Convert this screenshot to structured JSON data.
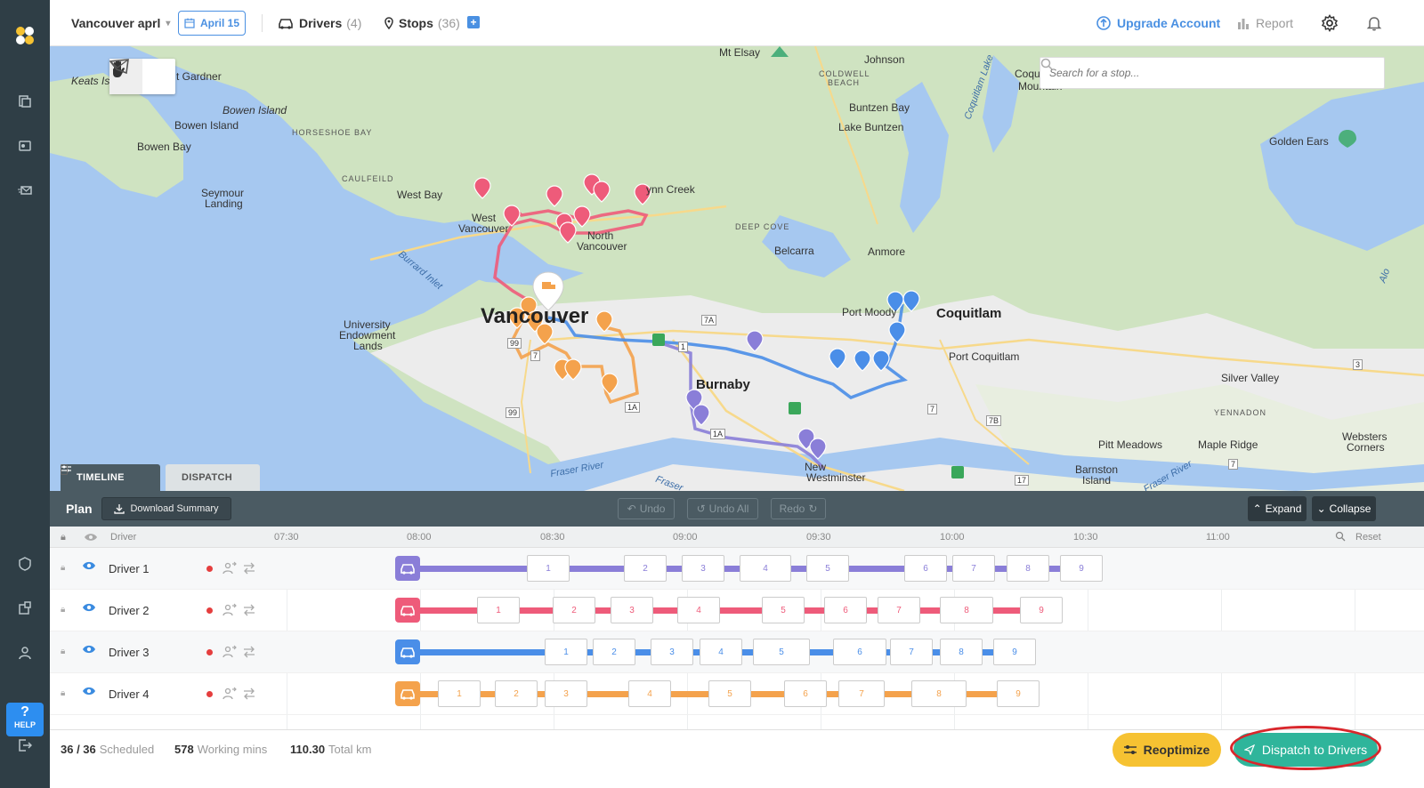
{
  "topbar": {
    "plan_name": "Vancouver aprl",
    "date": "April 15",
    "drivers_label": "Drivers",
    "drivers_count": "(4)",
    "stops_label": "Stops",
    "stops_count": "(36)",
    "upgrade_label": "Upgrade Account",
    "report_label": "Report"
  },
  "map": {
    "search_placeholder": "Search for a stop...",
    "labels": {
      "keats": "Keats Is",
      "gardner": "t Gardner",
      "bowen_island_1": "Bowen Island",
      "bowen_island_2": "Bowen Island",
      "bowen_bay": "Bowen Bay",
      "horseshoe": "HORSESHOE BAY",
      "caulfeild": "CAULFEILD",
      "west_bay": "West Bay",
      "seymour": "Seymour",
      "landing": "Landing",
      "west_van": "West",
      "west_van2": "Vancouver",
      "north_van": "North",
      "north_van2": "Vancouver",
      "lynn": "ynn Creek",
      "deep_cove": "DEEP COVE",
      "belcarra": "Belcarra",
      "anmore": "Anmore",
      "elsay": "Mt Elsay",
      "coldwell": "COLDWELL",
      "beach": "BEACH",
      "johnson": "Johnson",
      "buntzen_bay": "Buntzen Bay",
      "lake_buntzen": "Lake Buntzen",
      "coquitlam_lake": "Coquitlam Lake",
      "coquitlam_mtn": "Coquitlam",
      "coquitlam_mtn2": "Mountain",
      "golden_ears": "Golden Ears",
      "burrard": "Burrard Inlet",
      "vancouver": "Vancouver",
      "ubc": "University",
      "ubc2": "Endowment",
      "ubc3": "Lands",
      "burnaby": "Burnaby",
      "port_moody": "Port Moody",
      "coquitlam": "Coquitlam",
      "port_coquitlam": "Port Coquitlam",
      "silver_valley": "Silver Valley",
      "yennadon": "YENNADON",
      "pitt_meadows": "Pitt Meadows",
      "maple_ridge": "Maple Ridge",
      "websters": "Websters",
      "corners": "Corners",
      "barnston": "Barnston",
      "barnston2": "Island",
      "new_west": "New",
      "new_west2": "Westminster",
      "fraser": "Fraser River",
      "fraser2": "Fraser River",
      "fraser3": "Fraser",
      "alouette": "Alo",
      "rd7a": "7A",
      "rd99": "99",
      "rd99b": "99",
      "rd1a": "1A",
      "rd1ab": "1A",
      "rd7": "7",
      "rd7b": "7",
      "rd7bb": "7B",
      "rd17": "17",
      "rd1": "1",
      "rd7c": "7",
      "rd3": "3"
    }
  },
  "tabs": {
    "timeline": "TIMELINE",
    "dispatch": "DISPATCH"
  },
  "plan": {
    "title": "Plan",
    "download": "Download Summary",
    "undo": "Undo",
    "undo_all": "Undo All",
    "redo": "Redo",
    "expand": "Expand",
    "collapse": "Collapse",
    "reset": "Reset",
    "driver_col": "Driver"
  },
  "times": [
    "07:30",
    "08:00",
    "08:30",
    "09:00",
    "09:30",
    "10:00",
    "10:30",
    "11:00"
  ],
  "drivers": [
    {
      "name": "Driver 1",
      "color": "#8a7ed8",
      "stops": [
        "1",
        "2",
        "3",
        "4",
        "5",
        "6",
        "7",
        "8",
        "9"
      ]
    },
    {
      "name": "Driver 2",
      "color": "#ee5b7a",
      "stops": [
        "1",
        "2",
        "3",
        "4",
        "5",
        "6",
        "7",
        "8",
        "9"
      ]
    },
    {
      "name": "Driver 3",
      "color": "#4a8ee8",
      "stops": [
        "1",
        "2",
        "3",
        "4",
        "5",
        "6",
        "7",
        "8",
        "9"
      ]
    },
    {
      "name": "Driver 4",
      "color": "#f4a24c",
      "stops": [
        "1",
        "2",
        "3",
        "4",
        "5",
        "6",
        "7",
        "8",
        "9"
      ]
    }
  ],
  "footer": {
    "scheduled_value": "36 / 36",
    "scheduled_label": "Scheduled",
    "working_value": "578",
    "working_label": "Working mins",
    "km_value": "110.30",
    "km_label": "Total km",
    "reoptimize": "Reoptimize",
    "dispatch": "Dispatch to Drivers"
  },
  "help": {
    "q": "?",
    "label": "HELP"
  }
}
